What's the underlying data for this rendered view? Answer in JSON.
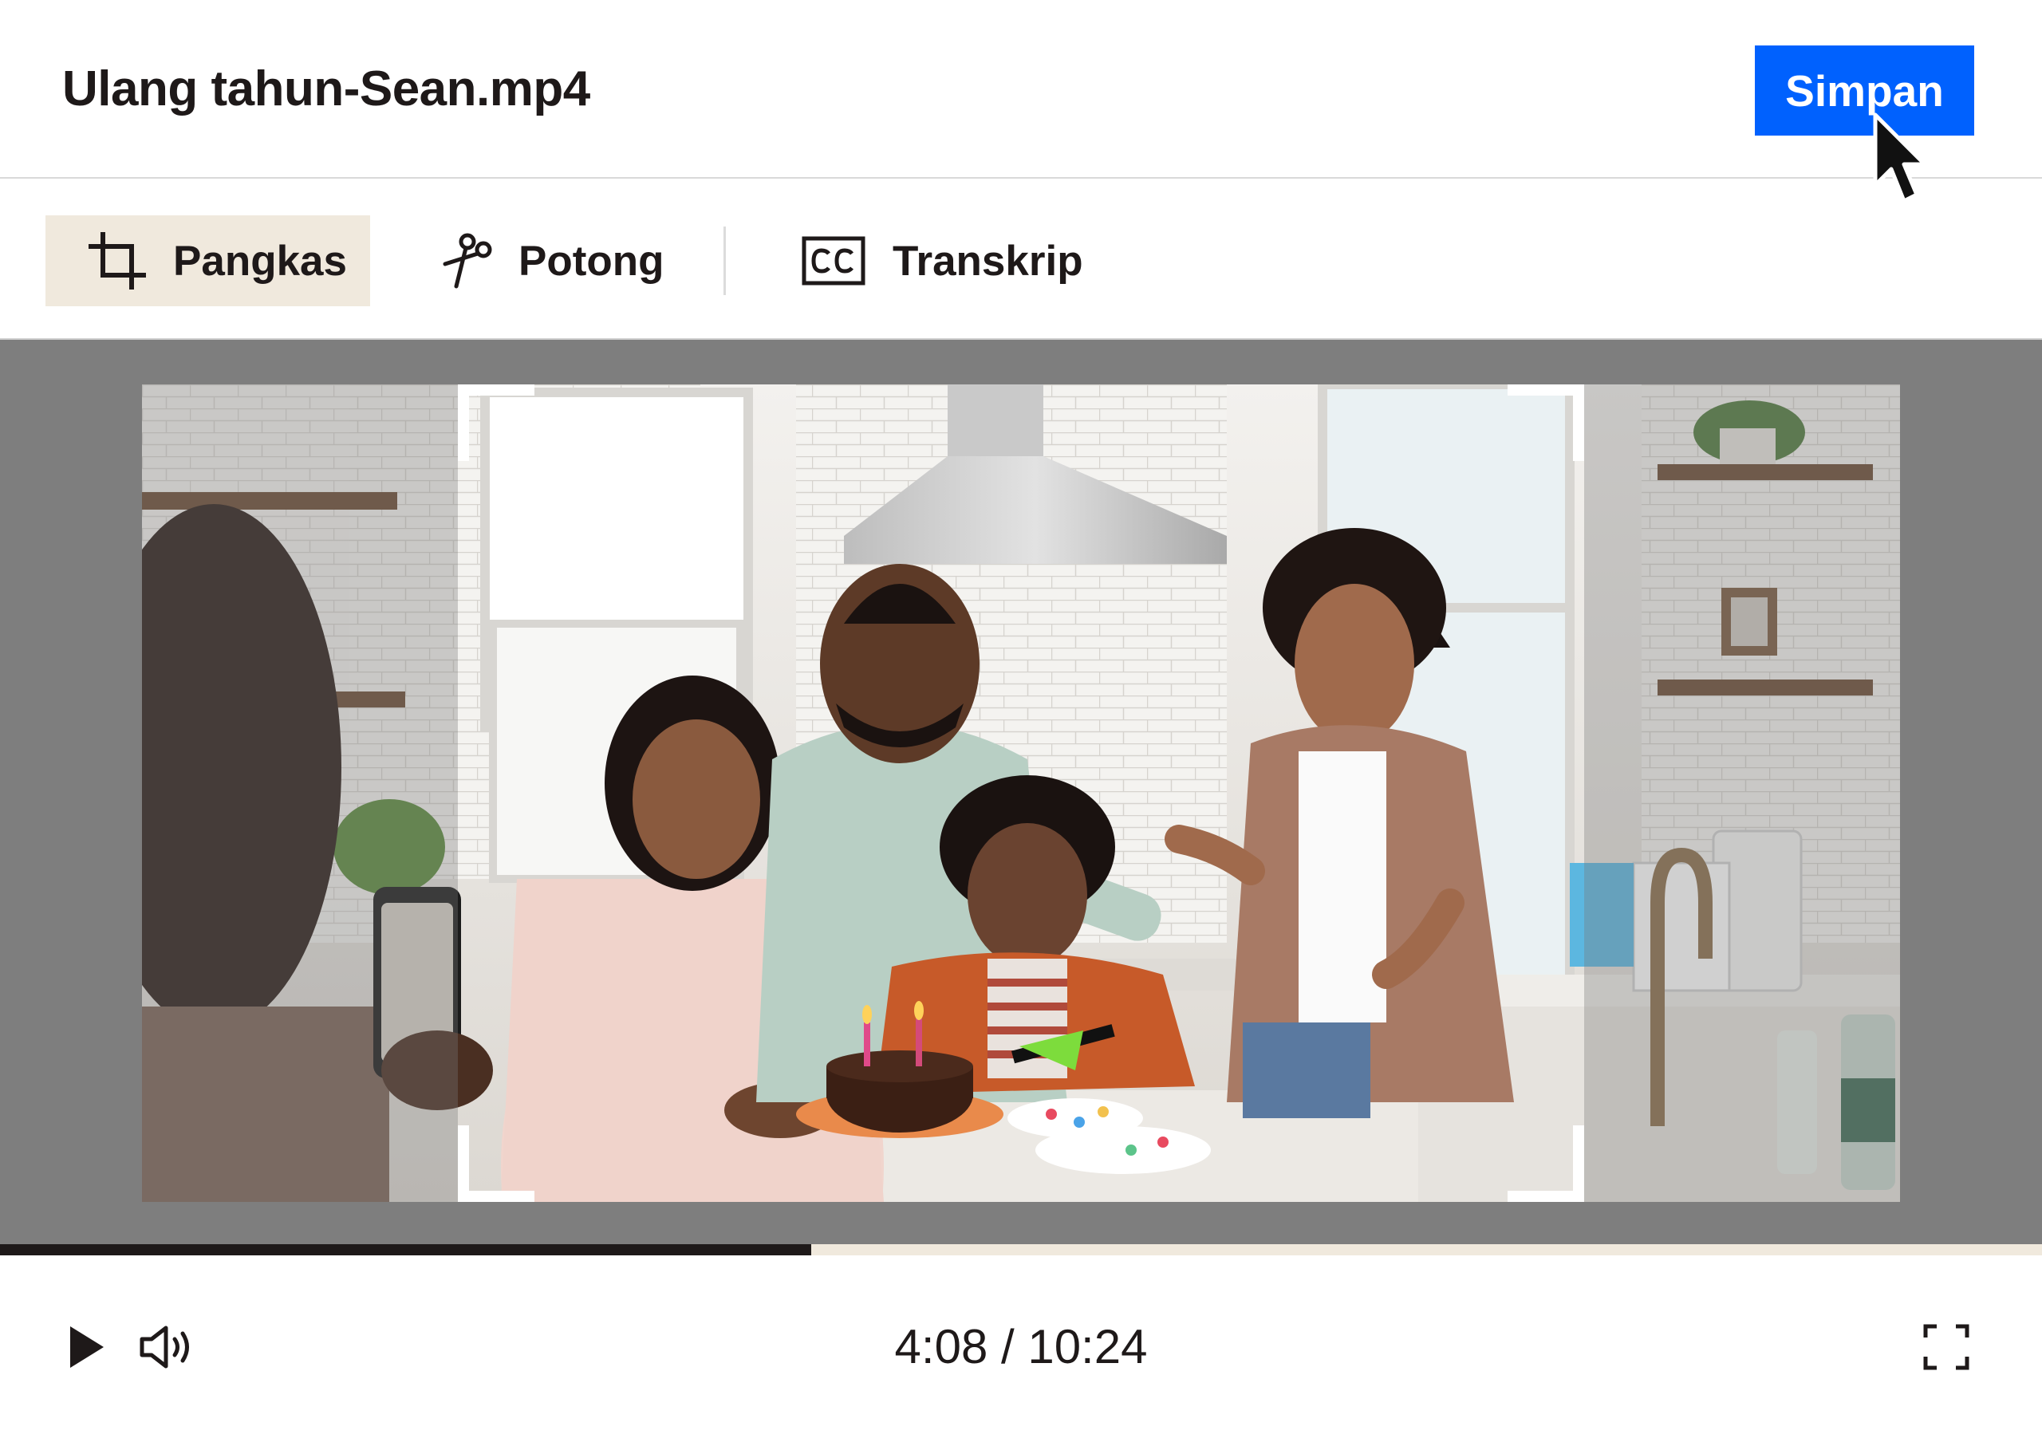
{
  "header": {
    "file_name": "Ulang tahun-Sean.mp4",
    "save_label": "Simpan"
  },
  "toolbar": {
    "tools": [
      {
        "label": "Pangkas",
        "icon": "crop-icon",
        "active": true
      },
      {
        "label": "Potong",
        "icon": "scissors-icon",
        "active": false
      },
      {
        "label": "Transkrip",
        "icon": "closed-captions-icon",
        "active": false
      }
    ]
  },
  "player": {
    "current_time": "4:08",
    "duration": "10:24",
    "time_text": "4:08 / 10:24",
    "progress_fraction": 0.3974
  },
  "video": {
    "scene": "family birthday in kitchen"
  },
  "colors": {
    "accent": "#0061fe",
    "active_tool_bg": "#f0e9dd",
    "stage_bg": "#7e7e7e",
    "text": "#1e1919"
  }
}
